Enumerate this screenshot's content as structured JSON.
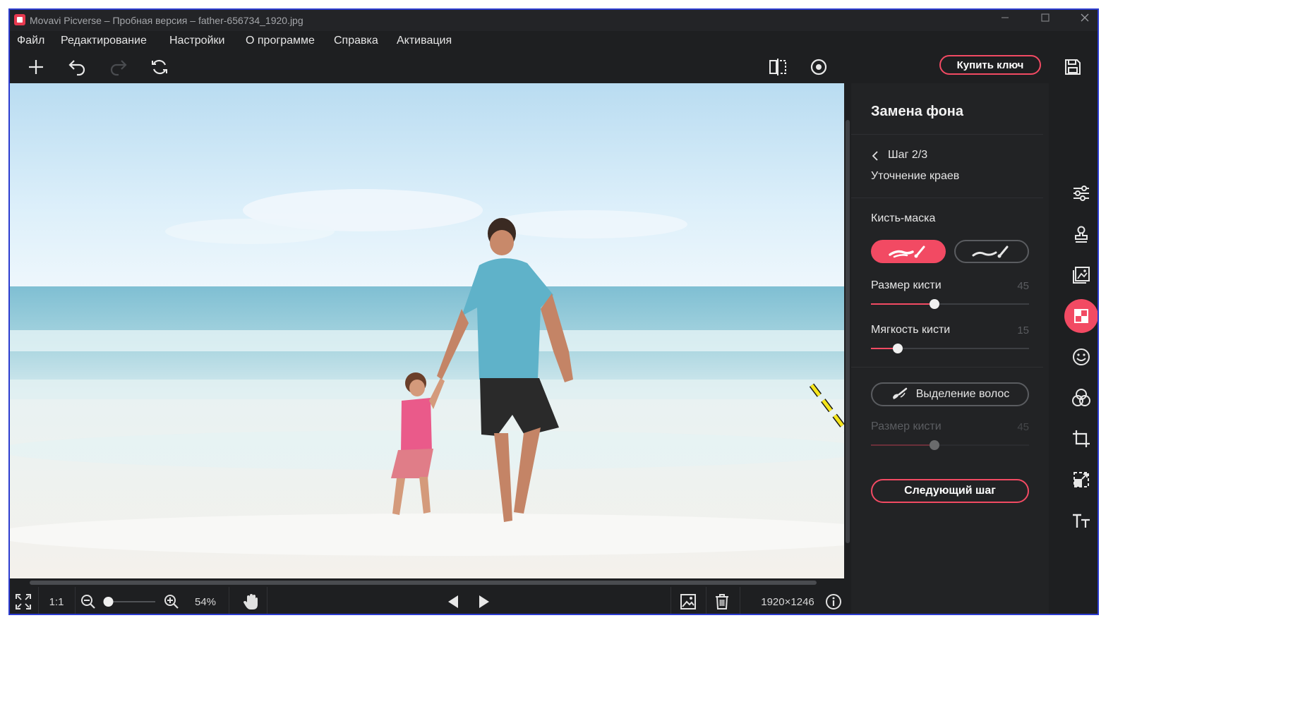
{
  "titlebar": {
    "title": "Movavi Picverse – Пробная версия – father-656734_1920.jpg"
  },
  "menu": [
    "Файл",
    "Редактирование",
    "Настройки",
    "О программе",
    "Справка",
    "Активация"
  ],
  "toolbar": {
    "left_icons": [
      "add-icon",
      "undo-icon",
      "redo-icon",
      "reset-icon"
    ],
    "center_icons": [
      "compare-icon",
      "preview-eye-icon"
    ],
    "buy_label": "Купить ключ",
    "save_icon": "save-icon"
  },
  "panel": {
    "title": "Замена фона",
    "step": "Шаг 2/3",
    "step_name": "Уточнение краев",
    "mask_brush_label": "Кисть-маска",
    "mask_modes": [
      {
        "name": "erase-brush-icon",
        "active": true
      },
      {
        "name": "restore-brush-icon",
        "active": false
      }
    ],
    "brush_size": {
      "label": "Размер кисти",
      "value": "45",
      "fraction": 0.4
    },
    "brush_softness": {
      "label": "Мягкость кисти",
      "value": "15",
      "fraction": 0.17
    },
    "hair_button": "Выделение волос",
    "hair_brush_size": {
      "label": "Размер кисти",
      "value": "45",
      "fraction": 0.4,
      "disabled": true
    },
    "next_button": "Следующий шаг"
  },
  "rail_icons": [
    "adjust-icon",
    "stamp-icon",
    "image-enhance-icon",
    "background-replace-icon",
    "face-retouch-icon",
    "color-filters-icon",
    "crop-icon",
    "resize-icon",
    "text-icon"
  ],
  "rail_active": "background-replace-icon",
  "bottombar": {
    "ratio_label": "1:1",
    "zoom": "54%",
    "zoom_fraction": 0.05,
    "dimensions": "1920×1246"
  },
  "colors": {
    "accent": "#f24a63",
    "background": "#1e1f21",
    "panel": "#222325",
    "annotation_arrow": "#f5e51b"
  }
}
